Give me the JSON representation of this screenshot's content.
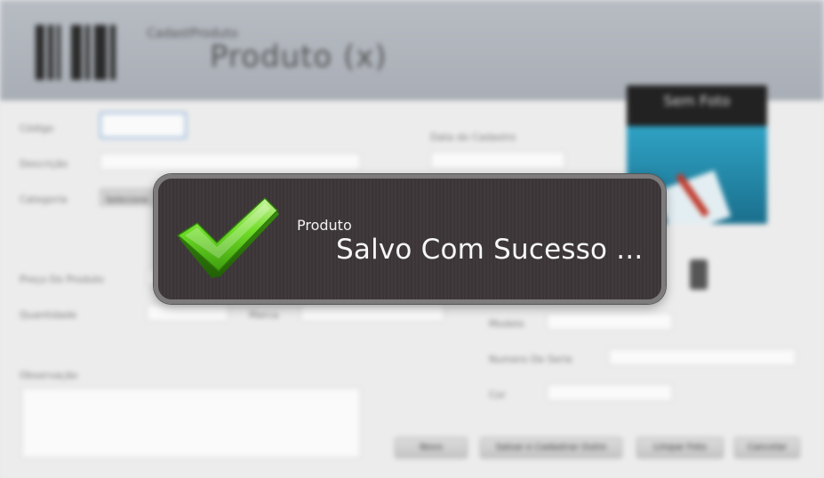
{
  "header": {
    "subtitle": "CadastProduto",
    "title": "Produto (x)"
  },
  "form": {
    "fields": {
      "codigo_label": "Código",
      "descricao_label": "Descrição",
      "categoria_label": "Categoria",
      "categoria_value": "Selecione",
      "data_cadastro_label": "Data do Cadastro",
      "preco_label": "Preço Do Produto",
      "quantidade_label": "Quantidade",
      "marca_label": "Marca",
      "observacao_label": "Observação",
      "modelo_label": "Modelo",
      "numero_serie_label": "Numero De Serie",
      "cor_label": "Cor"
    },
    "buttons": {
      "novo": "Novo",
      "salvar": "Salvar e Cadastrar Outro",
      "limpar": "Limpar Foto",
      "cancelar": "Cancelar"
    },
    "photo_placeholder": "Sem Foto"
  },
  "toast": {
    "caption": "Produto",
    "message": "Salvo Com Sucesso ...",
    "icon": "checkmark-icon",
    "icon_color": "#5fd61c"
  }
}
